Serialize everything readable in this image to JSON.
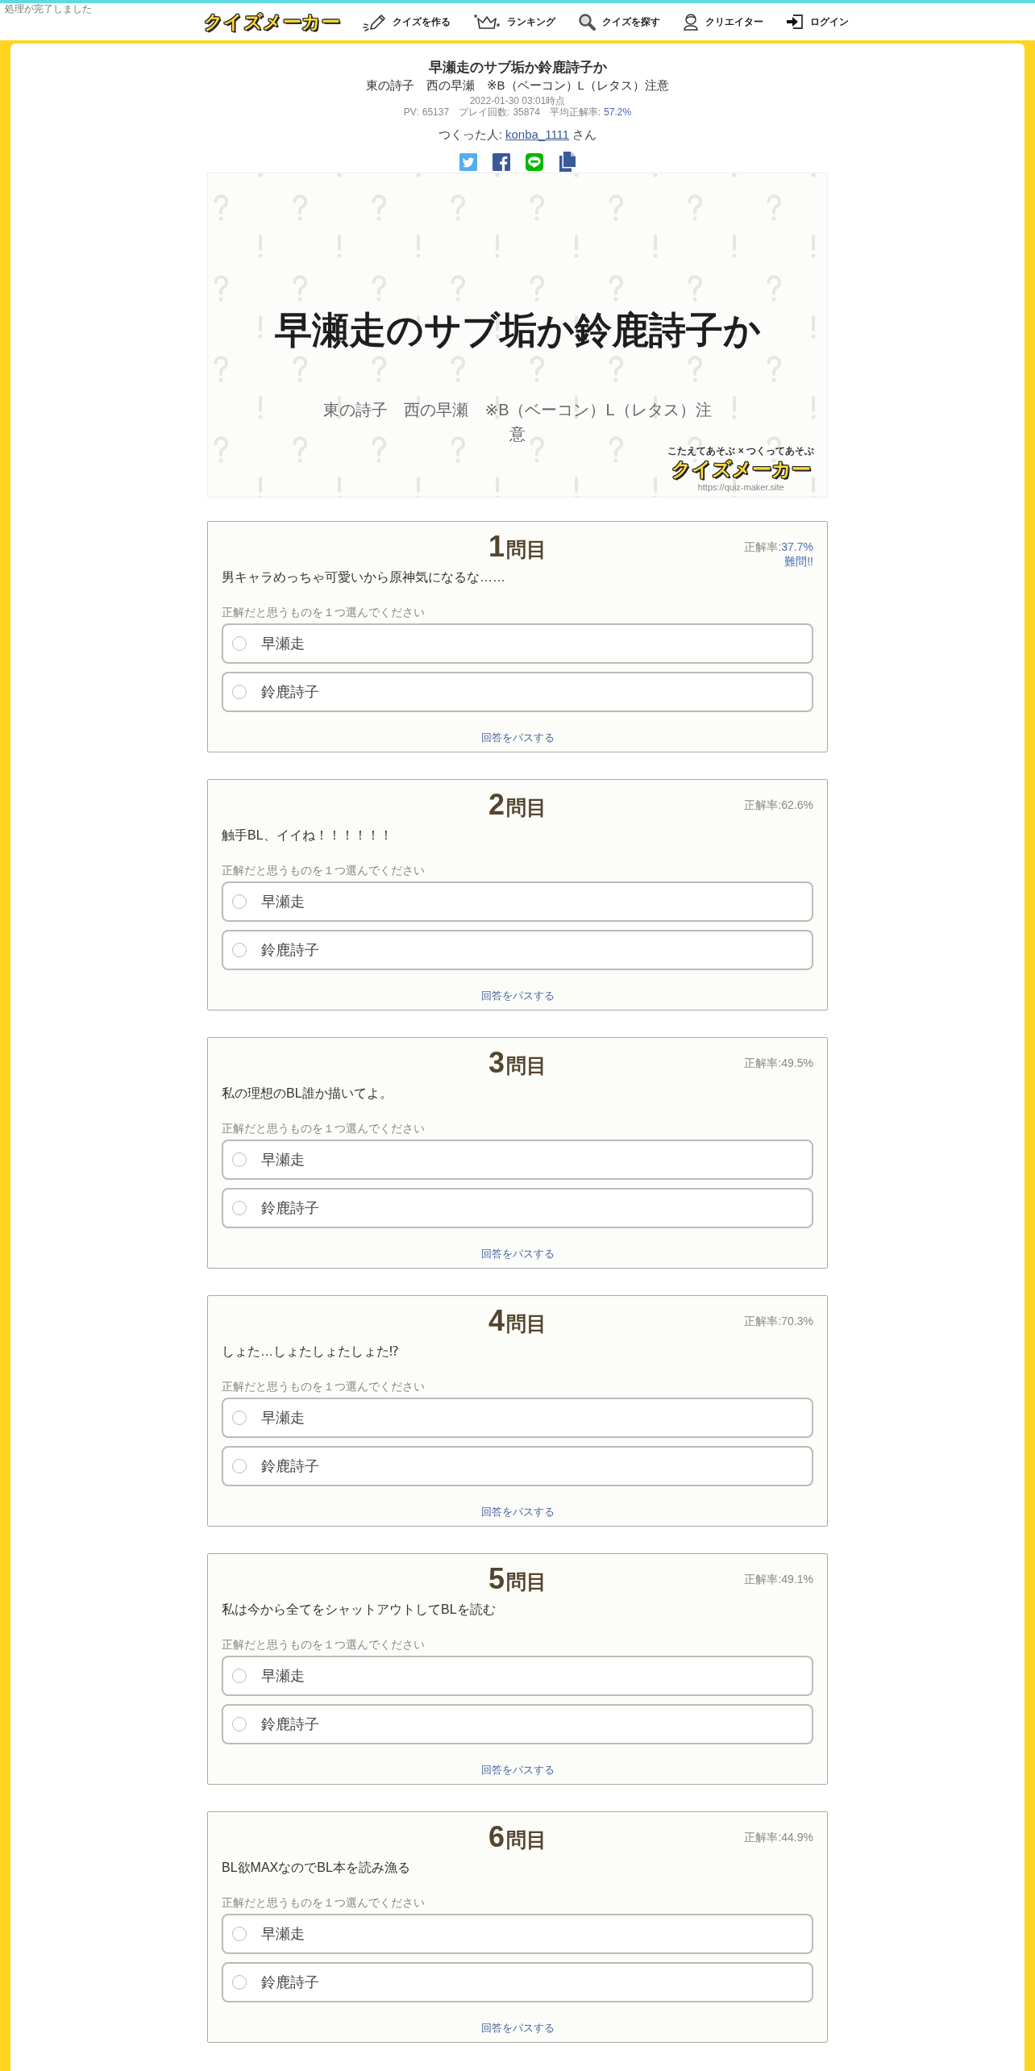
{
  "status_message": "処理が完了しました",
  "nav": {
    "logo": "クイズメーカー",
    "items": [
      {
        "kind": "create",
        "label": "クイズを作る"
      },
      {
        "kind": "ranking",
        "label": "ランキング"
      },
      {
        "kind": "search",
        "label": "クイズを探す"
      },
      {
        "kind": "creator",
        "label": "クリエイター"
      },
      {
        "kind": "login",
        "label": "ログイン"
      }
    ]
  },
  "quiz": {
    "title": "早瀬走のサブ垢か鈴鹿詩子か",
    "description": "東の詩子　西の早瀬　※B（ベーコン）L（レタス）注意",
    "timestamp": "2022-01-30 03:01時点",
    "stats": [
      {
        "label": "PV:",
        "value": "65137",
        "accent": false
      },
      {
        "label": "プレイ回数:",
        "value": "35874",
        "accent": false
      },
      {
        "label": "平均正解率:",
        "value": "57.2%",
        "accent": true
      }
    ],
    "author_label": "つくった人:",
    "author": "konba_1111",
    "author_suffix": "さん",
    "share_buttons": [
      {
        "kind": "twitter"
      },
      {
        "kind": "facebook"
      },
      {
        "kind": "line"
      },
      {
        "kind": "copy"
      }
    ]
  },
  "banner": {
    "title": "早瀬走のサブ垢か鈴鹿詩子か",
    "subtitle": "東の詩子　西の早瀬　※B（ベーコン）L（レタス）注意",
    "tagline": "こたえてあそぶ × つくってあそぶ",
    "logo": "クイズメーカー",
    "url": "https://quiz-maker.site"
  },
  "questions": [
    {
      "number": "1",
      "number_suffix": "問目",
      "rate_label": "正解率:",
      "rate": "37.7%",
      "hard": true,
      "difficulty": "難問!!",
      "text": "男キャラめっちゃ可愛いから原神気になるな……",
      "instruction": "正解だと思うものを１つ選んでください",
      "options": [
        {
          "label": "早瀬走",
          "selected": false
        },
        {
          "label": "鈴鹿詩子",
          "selected": false
        }
      ],
      "skip": "回答をパスする"
    },
    {
      "number": "2",
      "number_suffix": "問目",
      "rate_label": "正解率:",
      "rate": "62.6%",
      "hard": false,
      "text": "触手BL、イイね！！！！！！",
      "instruction": "正解だと思うものを１つ選んでください",
      "options": [
        {
          "label": "早瀬走",
          "selected": false
        },
        {
          "label": "鈴鹿詩子",
          "selected": false
        }
      ],
      "skip": "回答をパスする"
    },
    {
      "number": "3",
      "number_suffix": "問目",
      "rate_label": "正解率:",
      "rate": "49.5%",
      "hard": false,
      "text": "私の理想のBL誰か描いてよ。",
      "instruction": "正解だと思うものを１つ選んでください",
      "options": [
        {
          "label": "早瀬走",
          "selected": false
        },
        {
          "label": "鈴鹿詩子",
          "selected": false
        }
      ],
      "skip": "回答をパスする"
    },
    {
      "number": "4",
      "number_suffix": "問目",
      "rate_label": "正解率:",
      "rate": "70.3%",
      "hard": false,
      "text": "しょた…しょたしょたしょた⁉",
      "instruction": "正解だと思うものを１つ選んでください",
      "options": [
        {
          "label": "早瀬走",
          "selected": false
        },
        {
          "label": "鈴鹿詩子",
          "selected": false
        }
      ],
      "skip": "回答をパスする"
    },
    {
      "number": "5",
      "number_suffix": "問目",
      "rate_label": "正解率:",
      "rate": "49.1%",
      "hard": false,
      "text": "私は今から全てをシャットアウトしてBLを読む",
      "instruction": "正解だと思うものを１つ選んでください",
      "options": [
        {
          "label": "早瀬走",
          "selected": false
        },
        {
          "label": "鈴鹿詩子",
          "selected": false
        }
      ],
      "skip": "回答をパスする"
    },
    {
      "number": "6",
      "number_suffix": "問目",
      "rate_label": "正解率:",
      "rate": "44.9%",
      "hard": false,
      "text": "BL欲MAXなのでBL本を読み漁る",
      "instruction": "正解だと思うものを１つ選んでください",
      "options": [
        {
          "label": "早瀬走",
          "selected": false
        },
        {
          "label": "鈴鹿詩子",
          "selected": false
        }
      ],
      "skip": "回答をパスする"
    }
  ]
}
